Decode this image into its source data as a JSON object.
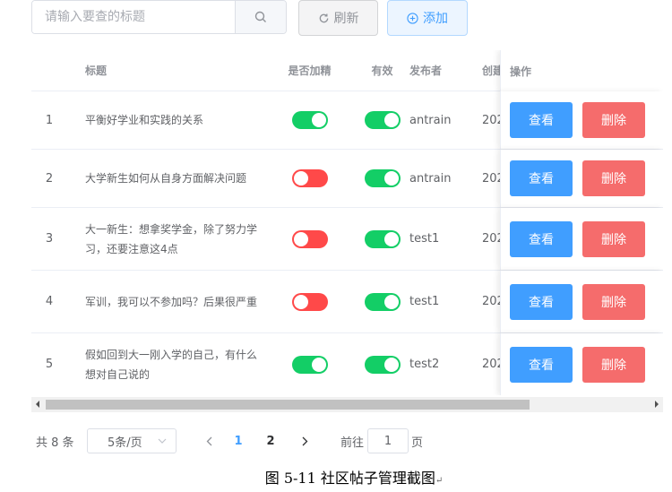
{
  "toolbar": {
    "search_placeholder": "请输入要查的标题",
    "refresh_label": "刷新",
    "add_label": "添加"
  },
  "table": {
    "headers": {
      "title": "标题",
      "featured": "是否加精",
      "valid": "有效",
      "publisher": "发布者",
      "created": "创建",
      "actions": "操作"
    },
    "rows": [
      {
        "index": "1",
        "title": "平衡好学业和实践的关系",
        "featured": true,
        "valid": true,
        "publisher": "antrain",
        "created": "202"
      },
      {
        "index": "2",
        "title": "大学新生如何从自身方面解决问题",
        "featured": false,
        "valid": true,
        "publisher": "antrain",
        "created": "202"
      },
      {
        "index": "3",
        "title": "大一新生：想拿奖学金，除了努力学习，还要注意这4点",
        "featured": false,
        "valid": true,
        "publisher": "test1",
        "created": "202"
      },
      {
        "index": "4",
        "title": "军训，我可以不参加吗？后果很严重",
        "featured": false,
        "valid": true,
        "publisher": "test1",
        "created": "202"
      },
      {
        "index": "5",
        "title": "假如回到大一刚入学的自己，有什么想对自己说的",
        "featured": true,
        "valid": true,
        "publisher": "test2",
        "created": "202"
      }
    ],
    "view_label": "查看",
    "delete_label": "删除"
  },
  "pagination": {
    "total": "共 8 条",
    "page_size": "5条/页",
    "pages": [
      "1",
      "2"
    ],
    "current_page": "1",
    "goto_label": "前往",
    "goto_value": "1",
    "page_suffix": "页"
  },
  "caption": "图 5-11 社区帖子管理截图",
  "colors": {
    "primary": "#409eff",
    "danger": "#f56c6c",
    "switch_on": "#13ce66",
    "switch_off": "#ff4949"
  }
}
